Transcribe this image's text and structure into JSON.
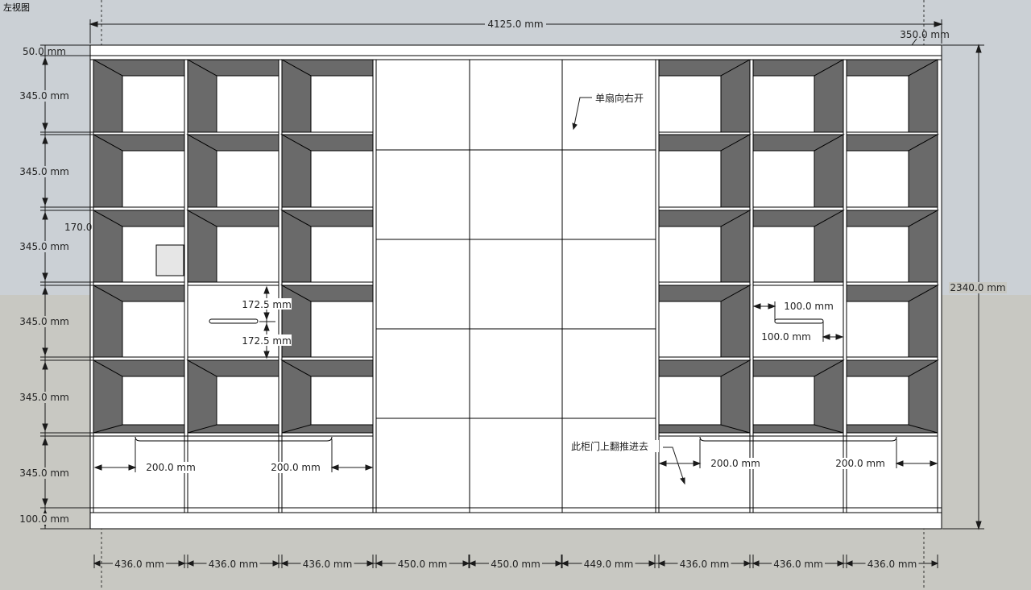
{
  "view_label": "左视图",
  "colors": {
    "sky": "#cbd0d5",
    "ground": "#c8c8c2",
    "cabinet_fill": "#ffffff",
    "shelf_dark": "#6a6a6a",
    "line": "#000000",
    "dim_line": "#1a1a1a"
  },
  "dimensions": {
    "overall_width": "4125.0 mm",
    "depth": "350.0 mm",
    "overall_height": "2340.0 mm",
    "top_board": "50.0 mm",
    "row_1": "345.0 mm",
    "row_2": "345.0 mm",
    "row_3": "345.0 mm",
    "row_4": "345.0 mm",
    "row_5": "345.0 mm",
    "row_6": "345.0 mm",
    "plinth": "100.0 mm",
    "partial_170": "170.0",
    "drawer_upper": "172.5 mm",
    "drawer_lower": "172.5 mm",
    "handle_offset_top": "100.0 mm",
    "handle_offset_bottom": "100.0 mm",
    "handle_left_1": "200.0 mm",
    "handle_left_2": "200.0 mm",
    "handle_right_1": "200.0 mm",
    "handle_right_2": "200.0 mm",
    "columns": [
      "436.0 mm",
      "436.0 mm",
      "436.0 mm",
      "450.0 mm",
      "450.0 mm",
      "449.0 mm",
      "436.0 mm",
      "436.0 mm",
      "436.0 mm"
    ]
  },
  "annotations": {
    "door_note": "单扇向右开",
    "flip_door_note": "此柜门上翻推进去"
  }
}
